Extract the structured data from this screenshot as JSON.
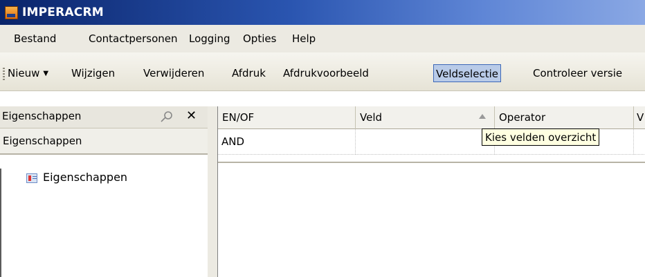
{
  "window": {
    "title": "IMPERACRM"
  },
  "menu": {
    "items": [
      "Bestand",
      "Contactpersonen",
      "Logging",
      "Opties",
      "Help"
    ]
  },
  "toolbar": {
    "items": [
      "Nieuw",
      "Wijzigen",
      "Verwijderen",
      "Afdruk",
      "Afdrukvoorbeeld",
      "Veldselectie",
      "Controleer versie"
    ],
    "active": "Veldselectie"
  },
  "left_panel": {
    "header": "Eigenschappen",
    "sub_header": "Eigenschappen",
    "tree_item": "Eigenschappen"
  },
  "grid": {
    "columns": [
      "EN/OF",
      "Veld",
      "Operator",
      "V"
    ],
    "rows": [
      [
        "AND",
        "",
        "",
        ""
      ]
    ]
  },
  "tooltip": {
    "text": "Kies velden overzicht"
  }
}
